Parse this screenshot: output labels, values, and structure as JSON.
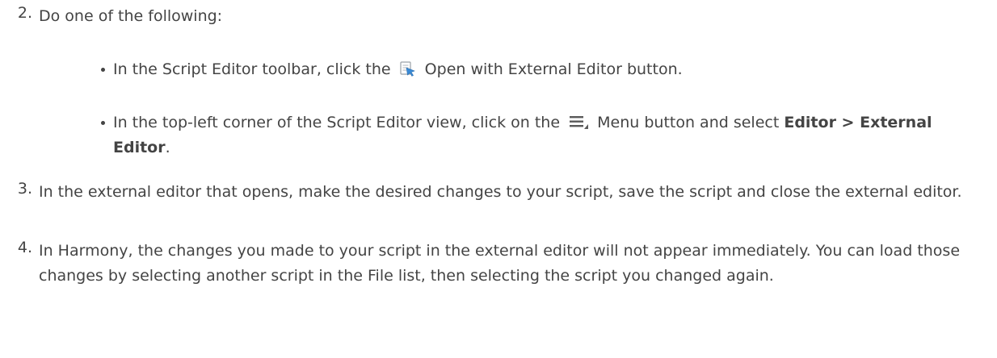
{
  "steps": [
    {
      "number": "2.",
      "text": "Do one of the following:"
    },
    {
      "number": "3.",
      "text": "In the external editor that opens, make the desired changes to your script, save the script and close the external editor."
    },
    {
      "number": "4.",
      "text": "In Harmony, the changes you made to your script in the external editor will not appear immediately. You can load those changes by selecting another script in the File list, then selecting the script you changed again."
    }
  ],
  "bullets": {
    "first": {
      "before": "In the Script Editor toolbar, click the",
      "icon": "open-external-editor-icon",
      "after": "Open with External Editor button."
    },
    "second": {
      "before": "In the top-left corner of the Script Editor view, click on the",
      "icon": "menu-icon",
      "middle": "Menu button and select",
      "bold_path": "Editor > External Editor",
      "after": "."
    }
  },
  "colors": {
    "text": "#444444",
    "icon_blue": "#3a8ad6",
    "icon_gray": "#5a5a5a"
  }
}
